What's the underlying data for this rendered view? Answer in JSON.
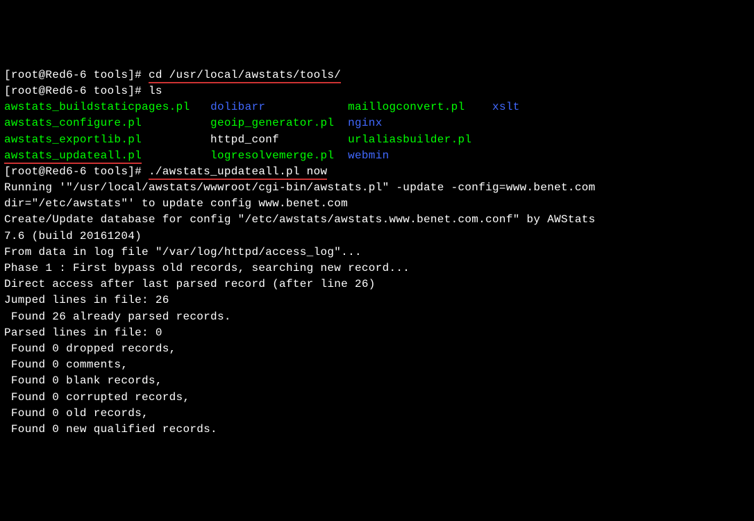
{
  "prompt": "[root@Red6-6 tools]# ",
  "cmd1": "cd /usr/local/awstats/tools/",
  "cmd2": "ls",
  "cmd3": "./awstats_updateall.pl now",
  "ls": {
    "c1r1": "awstats_buildstaticpages.pl",
    "c1r2": "awstats_configure.pl",
    "c1r3": "awstats_exportlib.pl",
    "c1r4": "awstats_updateall.pl",
    "c2r1": "dolibarr",
    "c2r2": "geoip_generator.pl",
    "c2r3": "httpd_conf",
    "c2r4": "logresolvemerge.pl",
    "c3r1": "maillogconvert.pl",
    "c3r2": "nginx",
    "c3r3": "urlaliasbuilder.pl",
    "c3r4": "webmin",
    "c4r1": "xslt"
  },
  "out": {
    "l1": "Running '\"/usr/local/awstats/wwwroot/cgi-bin/awstats.pl\" -update -config=www.benet.com",
    "l2": "dir=\"/etc/awstats\"' to update config www.benet.com",
    "l3": "Create/Update database for config \"/etc/awstats/awstats.www.benet.com.conf\" by AWStats",
    "l4": "7.6 (build 20161204)",
    "l5": "From data in log file \"/var/log/httpd/access_log\"...",
    "l6": "Phase 1 : First bypass old records, searching new record...",
    "l7": "Direct access after last parsed record (after line 26)",
    "l8": "Jumped lines in file: 26",
    "l9": " Found 26 already parsed records.",
    "l10": "Parsed lines in file: 0",
    "l11": " Found 0 dropped records,",
    "l12": " Found 0 comments,",
    "l13": " Found 0 blank records,",
    "l14": " Found 0 corrupted records,",
    "l15": " Found 0 old records,",
    "l16": " Found 0 new qualified records."
  }
}
